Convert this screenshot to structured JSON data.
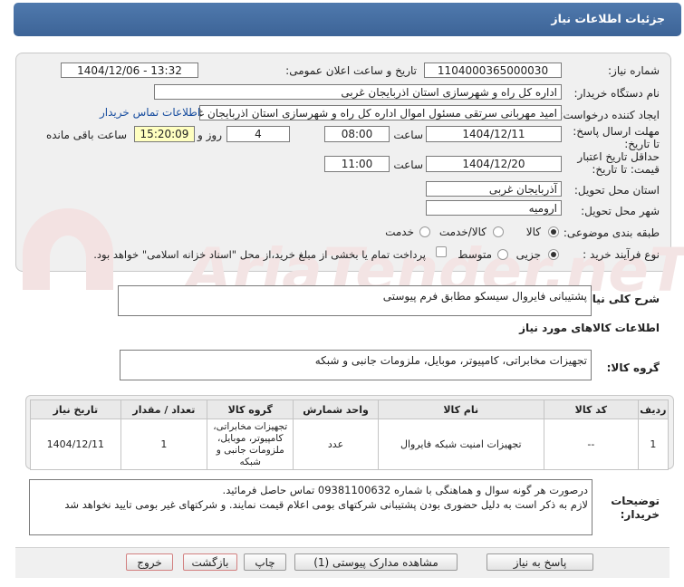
{
  "header": {
    "title": "جزئیات اطلاعات نیاز"
  },
  "watermark": {
    "text": "AriaTender.neT"
  },
  "form": {
    "need_number_label": "شماره نیاز:",
    "need_number": "1104000365000030",
    "announce_label": "تاریخ و ساعت اعلان عمومی:",
    "announce_value": "1404/12/06 - 13:32",
    "buyer_label": "نام دستگاه خریدار:",
    "buyer_value": "اداره کل راه و شهرسازی استان اذربایجان غربی",
    "creator_label": "ایجاد کننده درخواست:",
    "creator_value": "امید مهربانی سرتقی مسئول اموال اداره کل راه و شهرسازی استان اذربایجان غربی",
    "contact_link": "اطلاعات تماس خریدار",
    "deadline_label": "مهلت ارسال پاسخ: تا تاریخ:",
    "deadline_date": "1404/12/11",
    "time_label": "ساعت",
    "deadline_time": "08:00",
    "days_value": "4",
    "days_label": "روز و",
    "remaining_time": "15:20:09",
    "remaining_label": "ساعت باقی مانده",
    "validity_label": "حداقل تاریخ اعتبار قیمت: تا تاریخ:",
    "validity_date": "1404/12/20",
    "validity_time": "11:00",
    "province_label": "استان محل تحویل:",
    "province_value": "آذربایجان غربی",
    "city_label": "شهر محل تحویل:",
    "city_value": "ارومیه",
    "category_label": "طبقه بندی موضوعی:",
    "category_options": [
      "کالا",
      "کالا/خدمت",
      "خدمت"
    ],
    "process_label": "نوع فرآیند خرید :",
    "process_options": [
      "جزیی",
      "متوسط"
    ],
    "payment_note": "پرداخت تمام یا بخشی از مبلغ خرید،از محل \"اسناد خزانه اسلامی\" خواهد بود."
  },
  "description": {
    "label": "شرح کلی نیاز:",
    "value": "پشتیبانی فایروال سیسکو مطابق فرم پیوستی",
    "goods_info_title": "اطلاعات کالاهای مورد نیاز",
    "group_label": "گروه کالا:",
    "group_value": "تجهیزات مخابراتی، کامپیوتر، موبایل، ملزومات جانبی و شبکه"
  },
  "table": {
    "headers": [
      "ردیف",
      "کد کالا",
      "نام کالا",
      "واحد شمارش",
      "گروه کالا",
      "تعداد / مقدار",
      "تاریخ نیاز"
    ],
    "rows": [
      [
        "1",
        "--",
        "تجهیزات امنیت شبکه فایروال",
        "عدد",
        "تجهیزات مخابراتی، کامپیوتر، موبایل، ملزومات جانبی و شبکه",
        "1",
        "1404/12/11"
      ]
    ]
  },
  "notes": {
    "label": "توضیحات خریدار:",
    "line1": "درصورت هر گونه سوال و هماهنگی با شماره 09381100632  تماس حاصل فرمائید.",
    "line2": "لازم به ذکر است به دلیل حضوری بودن پشتیبانی شرکتهای بومی اعلام قیمت نمایند. و شرکتهای غیر بومی تایید نخواهد شد"
  },
  "buttons": {
    "reply": "پاسخ به نیاز",
    "attachments": "مشاهده مدارک پیوستی (1)",
    "print": "چاپ",
    "back": "بازگشت",
    "exit": "خروج"
  }
}
